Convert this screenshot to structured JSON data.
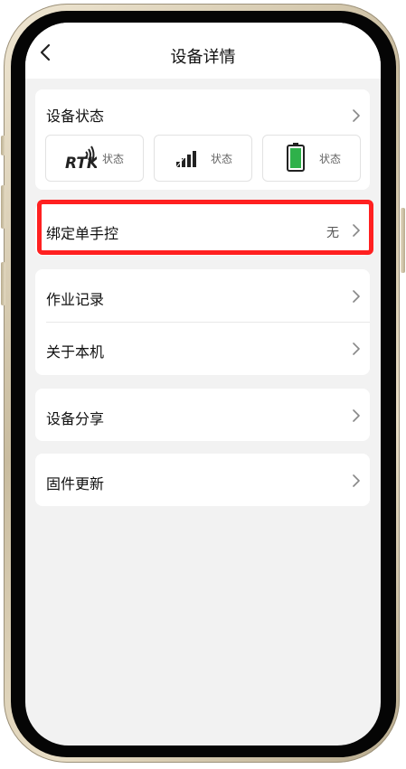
{
  "nav": {
    "title": "设备详情",
    "back_icon": "chevron-left-icon"
  },
  "device_status": {
    "label": "设备状态",
    "tiles": [
      {
        "icon": "rtk-signal-icon",
        "logo_text": "RTK",
        "label": "状态"
      },
      {
        "icon": "cellular-signal-icon",
        "label": "状态"
      },
      {
        "icon": "battery-icon",
        "label": "状态",
        "battery_color": "#2fb14a"
      }
    ]
  },
  "bind_controller": {
    "label": "绑定单手控",
    "value": "无"
  },
  "rows": {
    "work_records": "作业记录",
    "about_device": "关于本机",
    "device_share": "设备分享",
    "firmware_update": "固件更新"
  },
  "colors": {
    "highlight": "#ff2020",
    "background": "#f2f2f2"
  }
}
